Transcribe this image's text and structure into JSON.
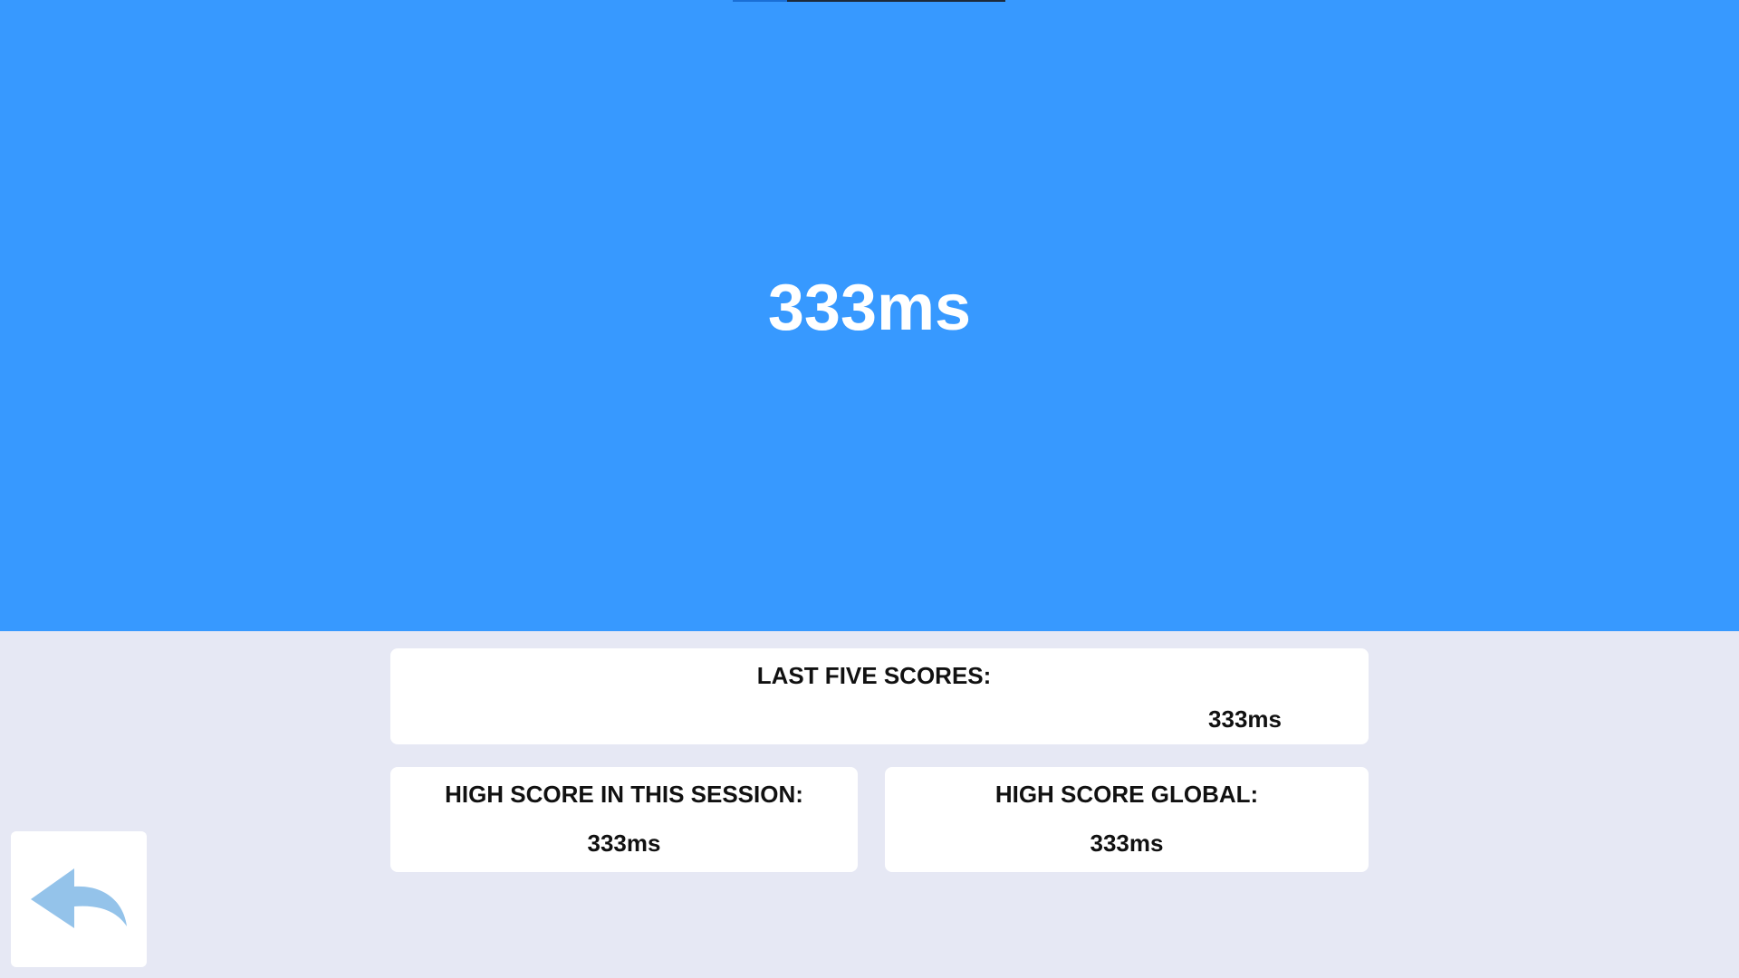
{
  "header": {
    "current_score": "333ms",
    "progress_fraction": 0.2
  },
  "last_five": {
    "title": "LAST FIVE SCORES:",
    "scores": [
      "333ms"
    ]
  },
  "session_high": {
    "title": "HIGH SCORE IN THIS SESSION:",
    "value": "333ms"
  },
  "global_high": {
    "title": "HIGH SCORE GLOBAL:",
    "value": "333ms"
  },
  "back_button": {
    "icon": "back-arrow-icon"
  },
  "colors": {
    "primary": "#3799ff",
    "background": "#e6e8f4",
    "card": "#ffffff",
    "icon": "#94c3ea"
  }
}
